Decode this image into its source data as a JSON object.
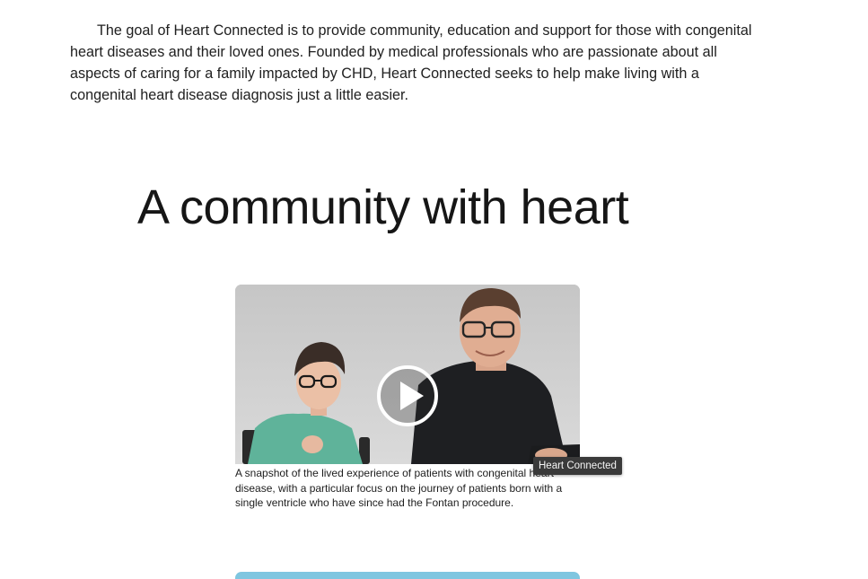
{
  "intro": {
    "text": "The goal of Heart Connected is to provide community, education and support for those with congenital heart diseases and their loved ones. Founded by medical professionals who are passionate about all aspects of caring for a family impacted by CHD, Heart Connected seeks to help make living with a congenital heart disease diagnosis just a little easier."
  },
  "section": {
    "headline": "A community with heart"
  },
  "video": {
    "caption": "A snapshot of the lived experience of patients with congenital heart disease, with a particular focus on the journey of patients born with a single ventricle who have since had the Fontan procedure.",
    "tooltip": "Heart Connected",
    "play_icon": "play-icon"
  },
  "next_video": {
    "accent_color": "#7fc6e0"
  }
}
